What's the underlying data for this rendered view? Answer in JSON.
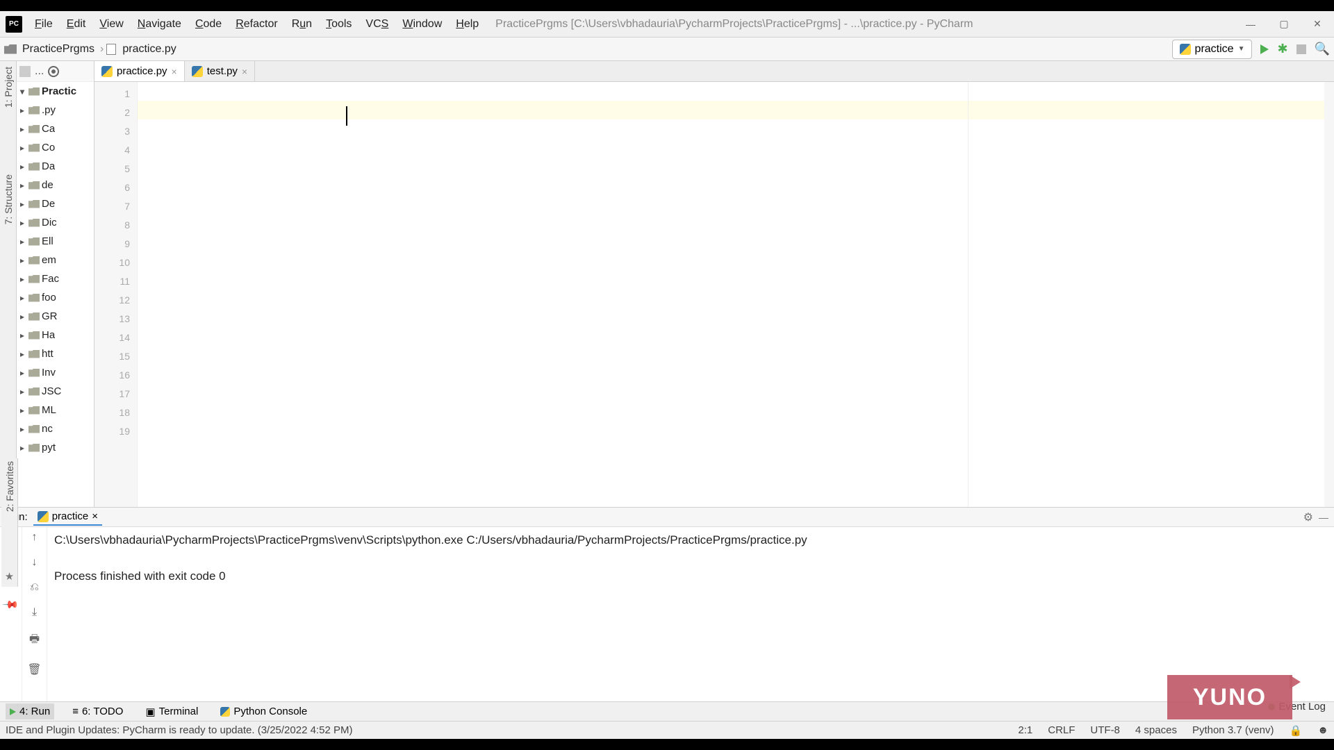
{
  "app_icon_text": "PC",
  "menu": {
    "file": "File",
    "edit": "Edit",
    "view": "View",
    "navigate": "Navigate",
    "code": "Code",
    "refactor": "Refactor",
    "run": "Run",
    "tools": "Tools",
    "vcs": "VCS",
    "window": "Window",
    "help": "Help"
  },
  "title_path": "PracticePrgms [C:\\Users\\vbhadauria\\PycharmProjects\\PracticePrgms] - ...\\practice.py - PyCharm",
  "breadcrumb": {
    "root": "PracticePrgms",
    "file": "practice.py"
  },
  "run_config": {
    "name": "practice"
  },
  "project": {
    "root": "Practic",
    "items": [
      ".py",
      "Ca",
      "Co",
      "Da",
      "de",
      "De",
      "Dic",
      "Ell",
      "em",
      "Fac",
      "foo",
      "GR",
      "Ha",
      "htt",
      "Inv",
      "JSC",
      "ML",
      "nc",
      "pyt"
    ]
  },
  "line_numbers": [
    1,
    2,
    3,
    4,
    5,
    6,
    7,
    8,
    9,
    10,
    11,
    12,
    13,
    14,
    15,
    16,
    17,
    18,
    19
  ],
  "tabs": {
    "t1": "practice.py",
    "t2": "test.py"
  },
  "run_header": {
    "label": "Run:",
    "tab": "practice"
  },
  "console": {
    "cmd": "C:\\Users\\vbhadauria\\PycharmProjects\\PracticePrgms\\venv\\Scripts\\python.exe C:/Users/vbhadauria/PycharmProjects/PracticePrgms/practice.py",
    "result": "Process finished with exit code 0"
  },
  "bottom": {
    "run": "4: Run",
    "todo": "6: TODO",
    "terminal": "Terminal",
    "pyconsole": "Python Console"
  },
  "status": {
    "msg": "IDE and Plugin Updates: PyCharm is ready to update. (3/25/2022 4:52 PM)",
    "pos": "2:1",
    "eol": "CRLF",
    "enc": "UTF-8",
    "indent": "4 spaces",
    "interp": "Python 3.7 (venv)"
  },
  "side_rails": {
    "project": "1: Project",
    "structure": "7: Structure",
    "favorites": "2: Favorites"
  },
  "event_log": "Event Log",
  "brand": "YUNO"
}
